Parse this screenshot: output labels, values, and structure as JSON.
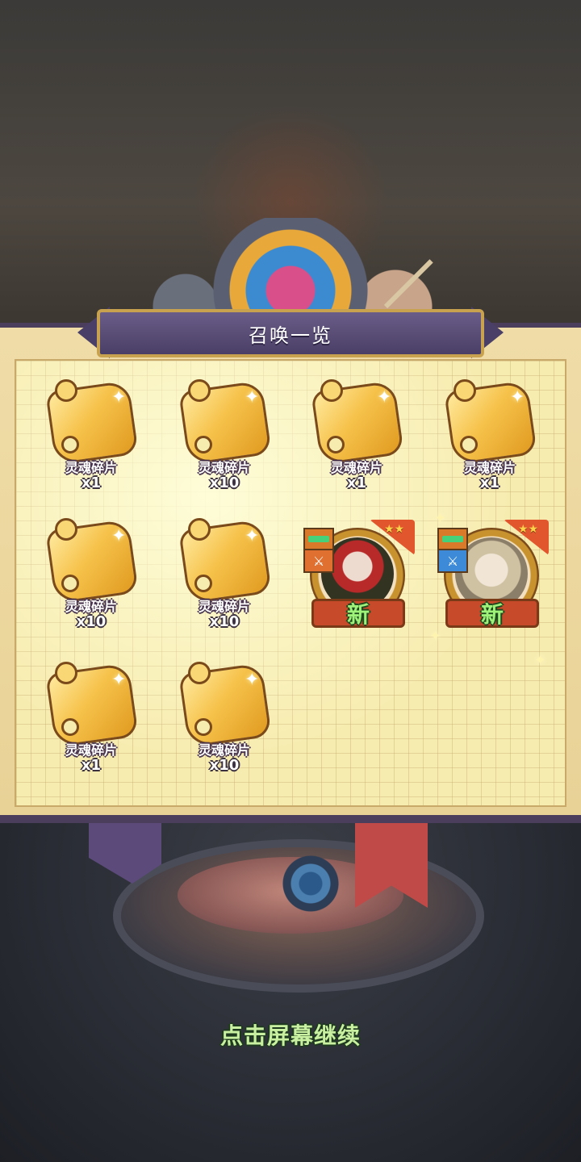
{
  "panel": {
    "title": "召唤一览"
  },
  "items": [
    {
      "name": "灵魂碎片",
      "qty": "x1"
    },
    {
      "name": "灵魂碎片",
      "qty": "x10"
    },
    {
      "name": "灵魂碎片",
      "qty": "x1"
    },
    {
      "name": "灵魂碎片",
      "qty": "x1"
    },
    {
      "name": "灵魂碎片",
      "qty": "x10"
    },
    {
      "name": "灵魂碎片",
      "qty": "x10"
    },
    {
      "name": "灵魂碎片",
      "qty": "x1"
    },
    {
      "name": "灵魂碎片",
      "qty": "x10"
    }
  ],
  "heroes": [
    {
      "badge": "新",
      "stars": "★★",
      "class_icon": "sword-icon",
      "accent": "#e07030"
    },
    {
      "badge": "新",
      "stars": "★★",
      "class_icon": "sword-icon",
      "accent": "#3d8bd8"
    }
  ],
  "footer": {
    "continue_text": "点击屏幕继续"
  }
}
